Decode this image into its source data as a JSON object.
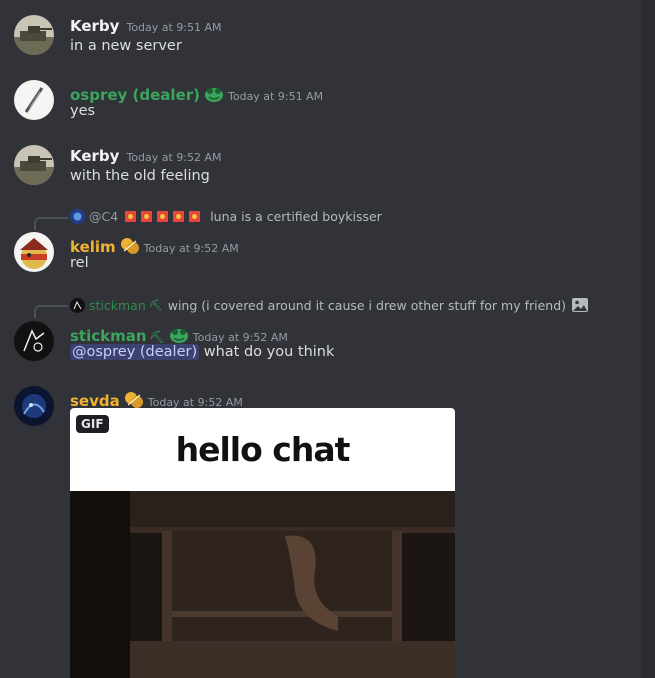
{
  "colors": {
    "background": "#313338",
    "name_white": "#f2f3f5",
    "name_green": "#3ba55d",
    "name_gold": "#f0b232",
    "timestamp": "#949ba4",
    "mention_bg": "#4752c4"
  },
  "messages": [
    {
      "author": "Kerby",
      "timestamp": "Today at 9:51 AM",
      "text": "in a new server"
    },
    {
      "author": "osprey (dealer)",
      "timestamp": "Today at 9:51 AM",
      "text": "yes",
      "badge": "frog-badge-icon"
    },
    {
      "author": "Kerby",
      "timestamp": "Today at 9:52 AM",
      "text": "with the old feeling"
    },
    {
      "author": "kelim",
      "timestamp": "Today at 9:52 AM",
      "text": "rel",
      "badge": "gold-badge-icon",
      "reply": {
        "author": "@C4",
        "text": "luna is a certified boykisser"
      }
    },
    {
      "author": "stickman",
      "timestamp": "Today at 9:52 AM",
      "badge": "frog-badge-icon",
      "mention": "@osprey (dealer)",
      "text": " what do you think",
      "reply": {
        "author": "stickman",
        "text": "wing (i covered around it cause i drew other stuff for my friend)"
      }
    },
    {
      "author": "sevda",
      "timestamp": "Today at 9:52 AM",
      "badge": "gold-badge-icon",
      "gif": {
        "label": "GIF",
        "caption": "hello chat"
      }
    }
  ]
}
